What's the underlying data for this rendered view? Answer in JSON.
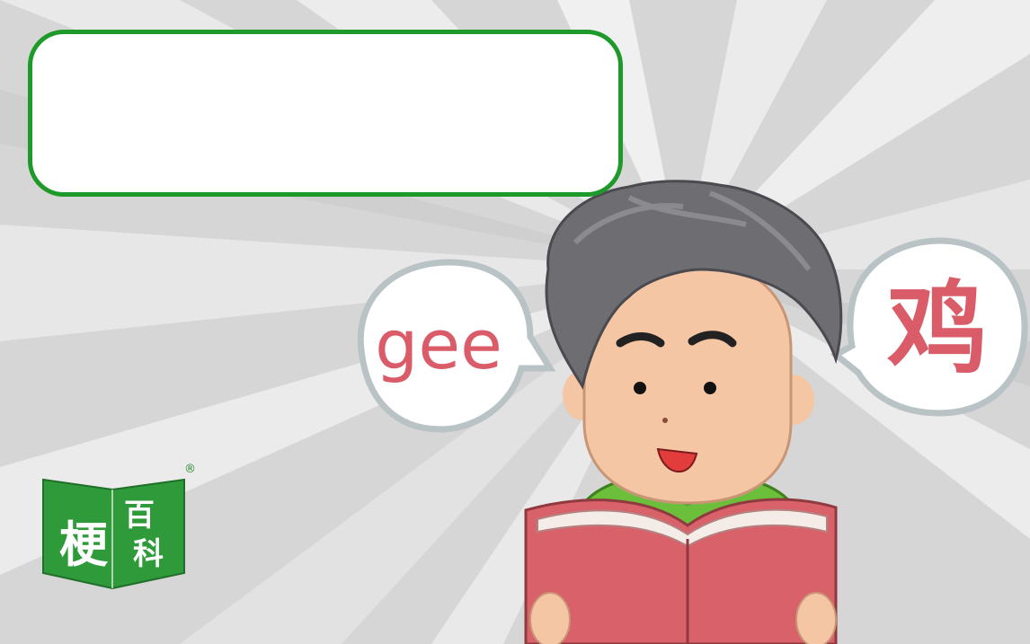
{
  "bubbles": {
    "left_text": "gee",
    "right_text": "鸡"
  },
  "logo": {
    "char_main": "梗",
    "char_top": "百",
    "char_bottom": "科",
    "registered": "®"
  },
  "colors": {
    "frame_green": "#1e9a2a",
    "bubble_red": "#d95c68",
    "logo_green": "#2e9a3a",
    "book_red": "#d9626a",
    "shirt_green": "#6cbf3a"
  }
}
